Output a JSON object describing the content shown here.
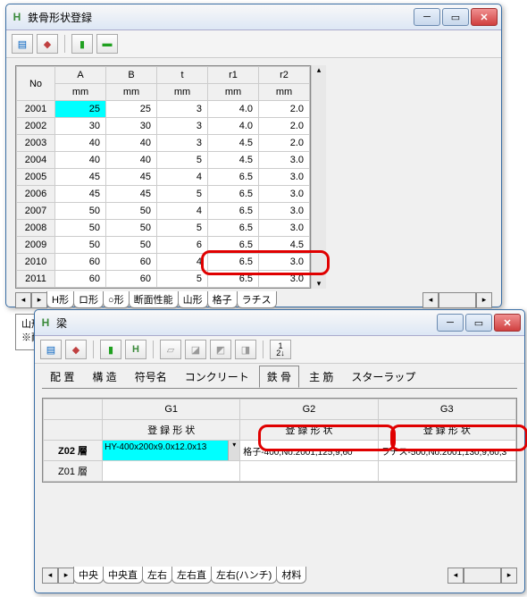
{
  "win1": {
    "title": "鉄骨形状登録",
    "noLabel": "No",
    "unit": "mm",
    "cols": [
      "A",
      "B",
      "t",
      "r1",
      "r2"
    ],
    "rows": [
      {
        "no": "2001",
        "v": [
          "25",
          "25",
          "3",
          "4.0",
          "2.0"
        ]
      },
      {
        "no": "2002",
        "v": [
          "30",
          "30",
          "3",
          "4.0",
          "2.0"
        ]
      },
      {
        "no": "2003",
        "v": [
          "40",
          "40",
          "3",
          "4.5",
          "2.0"
        ]
      },
      {
        "no": "2004",
        "v": [
          "40",
          "40",
          "5",
          "4.5",
          "3.0"
        ]
      },
      {
        "no": "2005",
        "v": [
          "45",
          "45",
          "4",
          "6.5",
          "3.0"
        ]
      },
      {
        "no": "2006",
        "v": [
          "45",
          "45",
          "5",
          "6.5",
          "3.0"
        ]
      },
      {
        "no": "2007",
        "v": [
          "50",
          "50",
          "4",
          "6.5",
          "3.0"
        ]
      },
      {
        "no": "2008",
        "v": [
          "50",
          "50",
          "5",
          "6.5",
          "3.0"
        ]
      },
      {
        "no": "2009",
        "v": [
          "50",
          "50",
          "6",
          "6.5",
          "4.5"
        ]
      },
      {
        "no": "2010",
        "v": [
          "60",
          "60",
          "4",
          "6.5",
          "3.0"
        ]
      },
      {
        "no": "2011",
        "v": [
          "60",
          "60",
          "5",
          "6.5",
          "3.0"
        ]
      }
    ],
    "tabs": [
      "H形",
      "ロ形",
      "○形",
      "断面性能",
      "山形",
      "格子",
      "ラチス"
    ],
    "note1": "山形鋼・格子材・ラチス材",
    "note2": "※耐震診断を目的とした入力項目です。"
  },
  "win2": {
    "title": "梁",
    "tabs2": [
      "配 置",
      "構 造",
      "符号名",
      "コンクリート",
      "鉄 骨",
      "主 筋",
      "スターラップ"
    ],
    "colGroups": [
      "G1",
      "G2",
      "G3"
    ],
    "subhead": "登 録 形 状",
    "rowLabels": [
      "Z02 層",
      "Z01 層"
    ],
    "row1": [
      "HY-400x200x9.0x12.0x13",
      "格子-400,No.2001,125,9,60",
      "ラチス-500,No.2001,130,9,60,3"
    ],
    "tabsB": [
      "中央",
      "中央直",
      "左右",
      "左右直",
      "左右(ハンチ)",
      "材料"
    ],
    "numLabel": "1\n2"
  }
}
